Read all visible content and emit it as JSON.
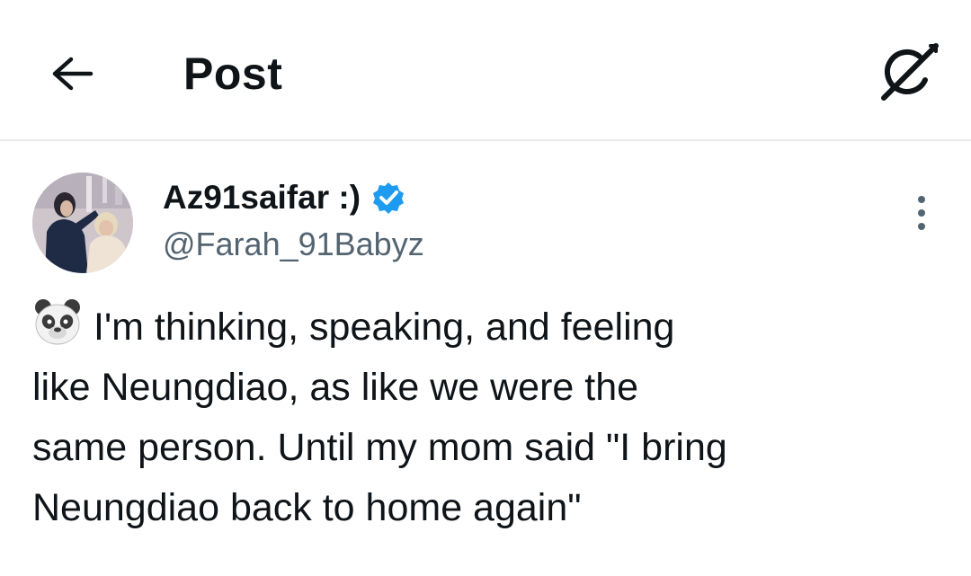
{
  "header": {
    "title": "Post",
    "back_icon": "arrow-left-icon",
    "grok_icon": "grok-icon"
  },
  "author": {
    "display_name": "Az91saifar :)",
    "handle": "@Farah_91Babyz",
    "verified_icon": "verified-badge-icon",
    "verified_color": "#1d9bf0"
  },
  "tweet": {
    "emoji": "panda-face-icon",
    "lines": [
      "I'm thinking, speaking, and feeling",
      "like Neungdiao, as like we were the",
      "same person. Until my mom said \"I bring",
      "Neungdiao back to home again\""
    ]
  },
  "colors": {
    "text": "#0f1419",
    "secondary": "#536471",
    "divider": "#e8ebed",
    "accent": "#1d9bf0"
  }
}
